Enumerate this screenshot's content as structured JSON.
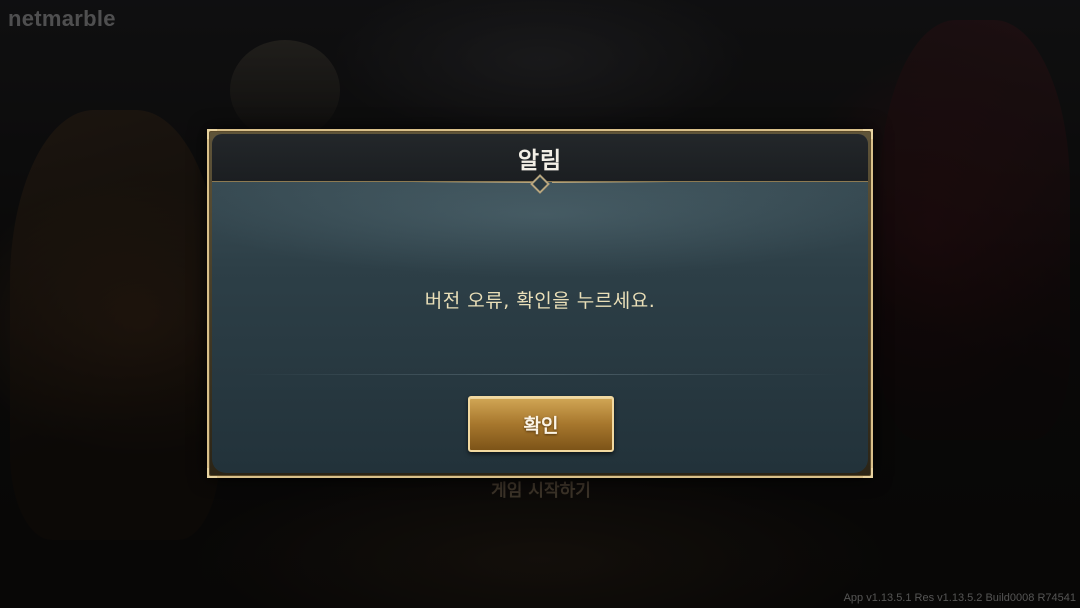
{
  "background": {
    "brand": "netmarble",
    "start_label": "게임 시작하기",
    "version": "App v1.13.5.1 Res v1.13.5.2 Build0008 R74541"
  },
  "dialog": {
    "title": "알림",
    "message": "버전 오류, 확인을 누르세요.",
    "confirm_label": "확인"
  },
  "colors": {
    "frame_gold": "#d9c08a",
    "button_gold": "#a7772d",
    "panel_teal": "#2d3f47",
    "message_text": "#eadfb8"
  }
}
